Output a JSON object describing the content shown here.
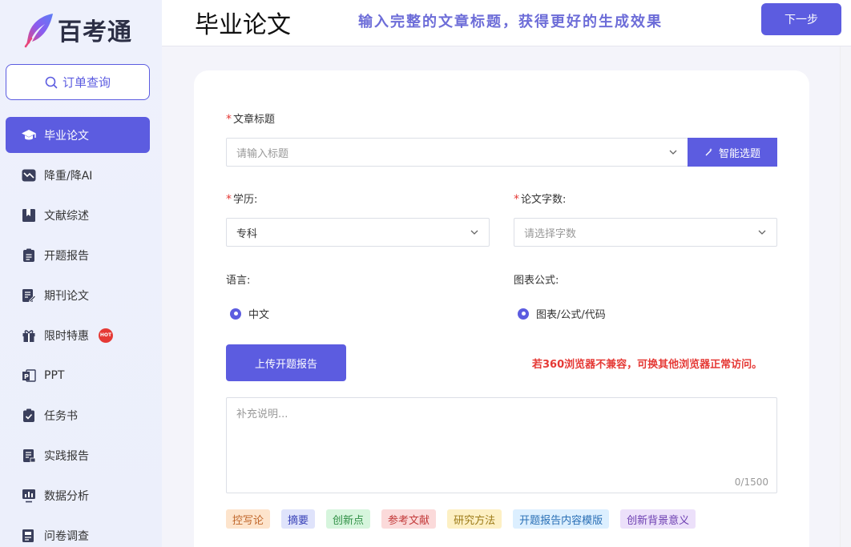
{
  "brand": {
    "name": "百考通"
  },
  "sidebar": {
    "order_query": "订单查询",
    "items": [
      {
        "label": "毕业论文",
        "icon": "graduation-cap-icon",
        "active": true
      },
      {
        "label": "降重/降AI",
        "icon": "trend-down-icon"
      },
      {
        "label": "文献综述",
        "icon": "book-icon"
      },
      {
        "label": "开题报告",
        "icon": "clipboard-icon"
      },
      {
        "label": "期刊论文",
        "icon": "edit-document-icon"
      },
      {
        "label": "限时特惠",
        "icon": "gift-icon",
        "badge": "HOT"
      },
      {
        "label": "PPT",
        "icon": "ppt-icon"
      },
      {
        "label": "任务书",
        "icon": "task-check-icon"
      },
      {
        "label": "实践报告",
        "icon": "report-icon"
      },
      {
        "label": "数据分析",
        "icon": "chart-icon"
      },
      {
        "label": "问卷调查",
        "icon": "survey-icon"
      }
    ]
  },
  "header": {
    "title": "毕业论文",
    "tip": "输入完整的文章标题，获得更好的生成效果",
    "next_label": "下一步"
  },
  "form": {
    "title_label": "文章标题",
    "title_placeholder": "请输入标题",
    "smart_label": "智能选题",
    "education_label": "学历:",
    "education_value": "专科",
    "wordcount_label": "论文字数:",
    "wordcount_placeholder": "请选择字数",
    "language_label": "语言:",
    "language_option": "中文",
    "chart_label": "图表公式:",
    "chart_option": "图表/公式/代码",
    "upload_label": "上传开题报告",
    "warning": "若360浏览器不兼容，可换其他浏览器正常访问。",
    "notes_placeholder": "补充说明...",
    "notes_count": "0/1500"
  },
  "tags": [
    {
      "label": "控写论",
      "bg": "#fde4cc",
      "color": "#c0662a"
    },
    {
      "label": "摘要",
      "bg": "#dfe3fb",
      "color": "#3a43b8"
    },
    {
      "label": "创新点",
      "bg": "#d6f5dd",
      "color": "#2f8f45"
    },
    {
      "label": "参考文献",
      "bg": "#fbdada",
      "color": "#c33a3a"
    },
    {
      "label": "研究方法",
      "bg": "#fdf0c4",
      "color": "#9c7a17"
    },
    {
      "label": "开题报告内容模版",
      "bg": "#dcefff",
      "color": "#2a6fb5"
    },
    {
      "label": "创新背景意义",
      "bg": "#ece0fa",
      "color": "#6b3db0"
    }
  ],
  "colors": {
    "accent": "#5c5ce0",
    "warning": "#e53935"
  }
}
